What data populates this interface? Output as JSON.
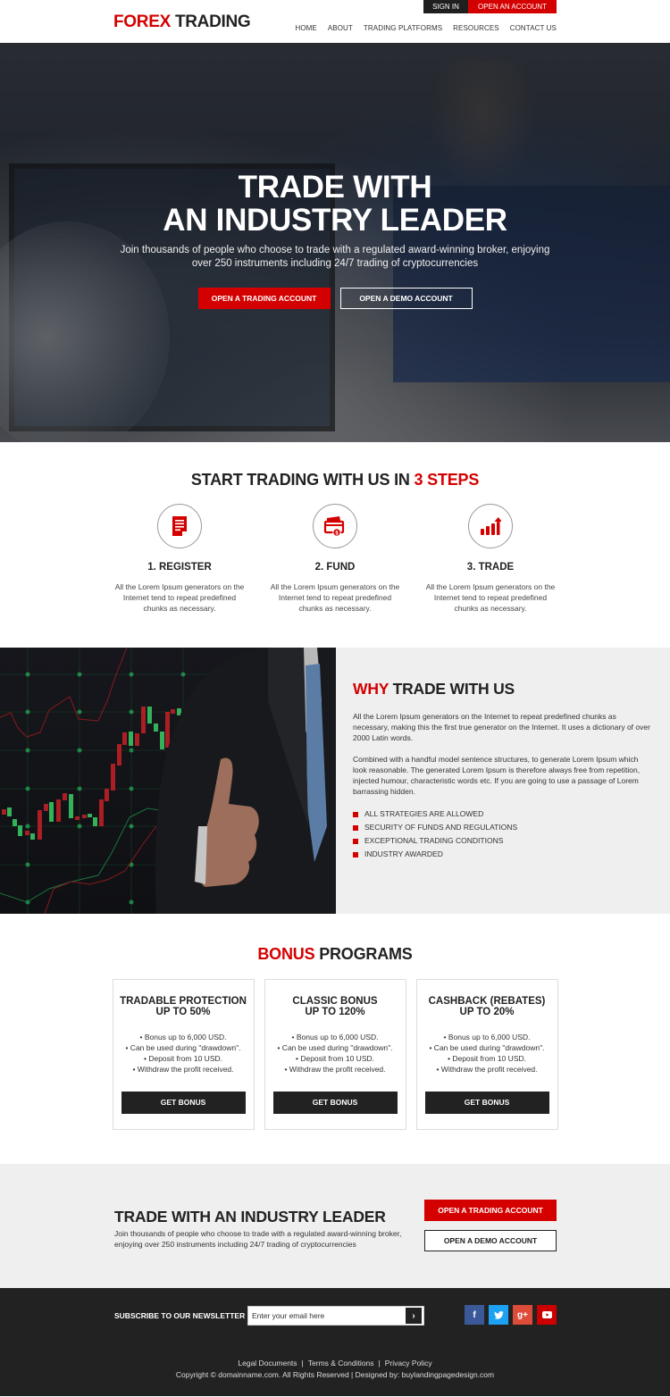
{
  "header": {
    "logo_part1": "FOREX",
    "logo_part2": "TRADING",
    "sign_in": "SIGN IN",
    "open_account": "OPEN AN ACCOUNT",
    "nav": [
      "HOME",
      "ABOUT",
      "TRADING PLATFORMS",
      "RESOURCES",
      "CONTACT US"
    ]
  },
  "hero": {
    "title_line1": "TRADE WITH",
    "title_line2": "AN INDUSTRY LEADER",
    "subtitle_line1": "Join thousands of people who choose to trade with a regulated award-winning broker, enjoying",
    "subtitle_line2": "over 250 instruments including 24/7 trading of cryptocurrencies",
    "btn_primary": "OPEN A TRADING ACCOUNT",
    "btn_secondary": "OPEN A DEMO ACCOUNT"
  },
  "steps": {
    "title_main": "START TRADING WITH US IN",
    "title_accent": "3 STEPS",
    "items": [
      {
        "icon": "document-icon",
        "title": "1. REGISTER",
        "text": "All the Lorem Ipsum generators on the Internet tend to repeat predefined chunks as necessary."
      },
      {
        "icon": "cards-money-icon",
        "title": "2. FUND",
        "text": "All the Lorem Ipsum generators on the Internet tend to repeat predefined chunks as necessary."
      },
      {
        "icon": "bar-chart-up-icon",
        "title": "3. TRADE",
        "text": "All the Lorem Ipsum generators on the Internet tend to repeat predefined chunks as necessary."
      }
    ]
  },
  "why": {
    "title_accent": "WHY",
    "title_main": "TRADE WITH US",
    "para1": "All the Lorem Ipsum generators on the Internet to repeat predefined chunks as necessary, making this the first true generator on the Internet. It uses a dictionary of over 2000 Latin words.",
    "para2": "Combined with a handful model sentence structures, to generate Lorem Ipsum which look reasonable. The generated Lorem Ipsum is therefore always free from repetition, injected humour, characteristic words etc. If you are going to use a passage of Lorem barrassing hidden.",
    "list": [
      "ALL STRATEGIES ARE ALLOWED",
      "SECURITY OF FUNDS AND REGULATIONS",
      "EXCEPTIONAL TRADING CONDITIONS",
      "INDUSTRY AWARDED"
    ]
  },
  "bonus": {
    "title_accent": "BONUS",
    "title_main": "PROGRAMS",
    "cards": [
      {
        "title1": "TRADABLE PROTECTION",
        "title2": "UP TO 50%",
        "features": [
          "• Bonus up to 6,000 USD.",
          "• Can be used during \"drawdown\".",
          "• Deposit from 10 USD.",
          "• Withdraw the profit received."
        ],
        "button": "GET BONUS"
      },
      {
        "title1": "CLASSIC BONUS",
        "title2": "UP TO 120%",
        "features": [
          "• Bonus up to 6,000 USD.",
          "• Can be used during \"drawdown\".",
          "• Deposit from 10 USD.",
          "• Withdraw the profit received."
        ],
        "button": "GET BONUS"
      },
      {
        "title1": "CASHBACK (REBATES)",
        "title2": "UP TO 20%",
        "features": [
          "• Bonus up to 6,000 USD.",
          "• Can be used during \"drawdown\".",
          "• Deposit from 10 USD.",
          "• Withdraw the profit received."
        ],
        "button": "GET BONUS"
      }
    ]
  },
  "cta": {
    "title": "TRADE WITH AN INDUSTRY LEADER",
    "subtitle_line1": "Join thousands of people who choose to trade with a regulated award-winning broker,",
    "subtitle_line2": "enjoying over 250 instruments including 24/7 trading of cryptocurrencies",
    "btn_primary": "OPEN A TRADING ACCOUNT",
    "btn_secondary": "OPEN A DEMO ACCOUNT"
  },
  "footer": {
    "newsletter_label": "SUBSCRIBE TO OUR NEWSLETTER",
    "newsletter_placeholder": "Enter your email here",
    "submit_glyph": "›",
    "social": [
      {
        "name": "facebook-icon",
        "glyph": "f",
        "color": "#3b5998"
      },
      {
        "name": "twitter-icon",
        "glyph": "t",
        "color": "#1da1f2"
      },
      {
        "name": "google-plus-icon",
        "glyph": "g+",
        "color": "#dd4b39"
      },
      {
        "name": "youtube-icon",
        "glyph": "▶",
        "color": "#cc0000"
      }
    ],
    "links": [
      "Legal Documents",
      "Terms & Conditions",
      "Privacy Policy"
    ],
    "copyright": "Copyright © domainname.com. All Rights Reserved  |  Designed by: buylandingpagedesign.com"
  },
  "colors": {
    "accent": "#d40000",
    "dark": "#222222",
    "light_bg": "#efefef"
  }
}
